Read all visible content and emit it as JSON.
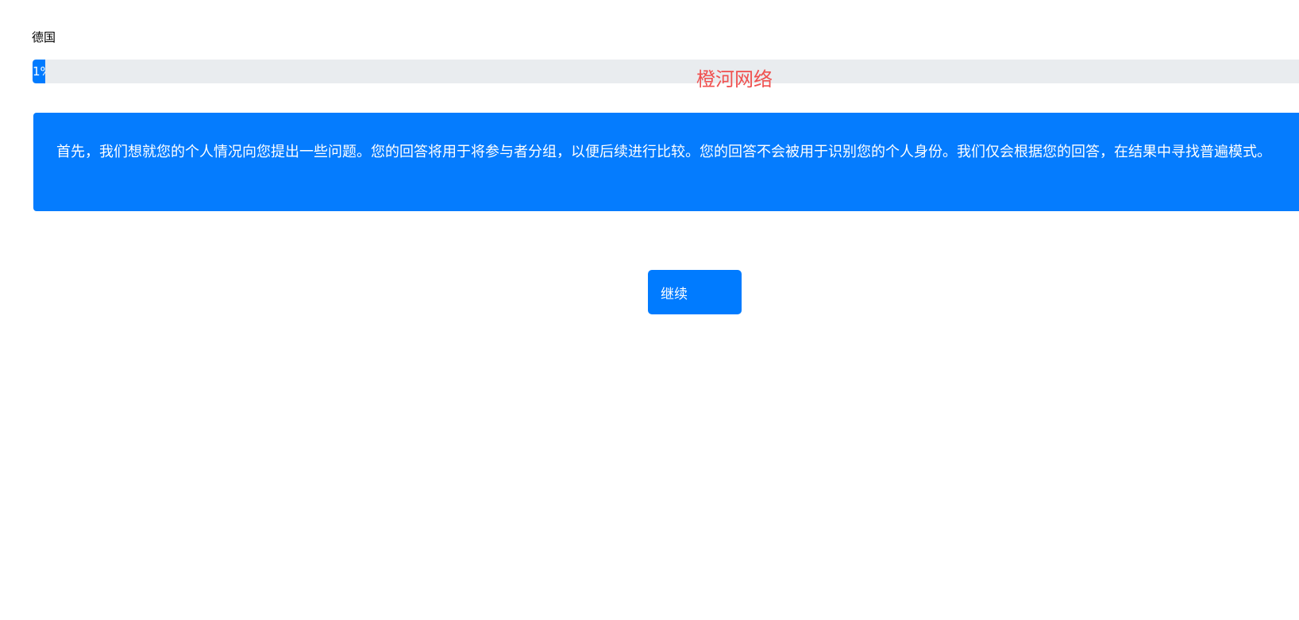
{
  "header": {
    "country_label": "德国"
  },
  "progress": {
    "value_percent": 1,
    "label": "1%"
  },
  "watermark": {
    "text": "橙河网络"
  },
  "intro": {
    "text": "首先，我们想就您的个人情况向您提出一些问题。您的回答将用于将参与者分组，以便后续进行比较。您的回答不会被用于识别您的个人身份。我们仅会根据您的回答，在结果中寻找普遍模式。"
  },
  "actions": {
    "continue_label": "继续"
  },
  "colors": {
    "primary": "#007bff",
    "info_box": "#057cfe",
    "progress_track": "#e9ecef",
    "watermark": "#f0504f"
  }
}
